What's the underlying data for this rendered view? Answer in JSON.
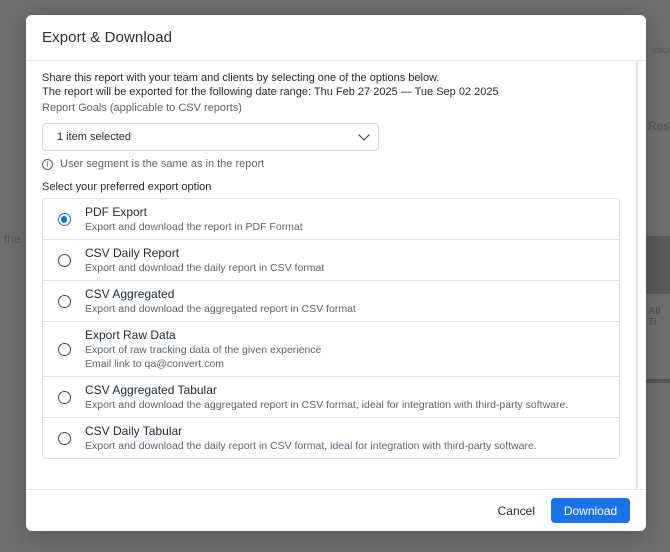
{
  "backdrop": {
    "left_fragment": "the",
    "right_fragment_1": "Rese",
    "right_fragment_2": "All Ti",
    "top_fragment": "ssion"
  },
  "modal": {
    "title": "Export & Download",
    "intro_line1": "Share this report with your team and clients by selecting one of the options below.",
    "intro_line2": "The report will be exported for the following date range: Thu Feb 27 2025 — Tue Sep 02 2025",
    "goals_label": "Report Goals (applicable to CSV reports)",
    "goals_select_value": "1 item selected",
    "info_text": "User segment is the same as in the report",
    "section_label": "Select your preferred export option",
    "options": [
      {
        "title": "PDF Export",
        "desc": "Export and download the report in PDF Format",
        "checked": true
      },
      {
        "title": "CSV Daily Report",
        "desc": "Export and download the daily report in CSV format",
        "checked": false
      },
      {
        "title": "CSV Aggregated",
        "desc": "Export and download the aggregated report in CSV format",
        "checked": false
      },
      {
        "title": "Export Raw Data",
        "desc": "Export of raw tracking data of the given experience",
        "desc2": "Email link to qa@convert.com",
        "checked": false
      },
      {
        "title": "CSV Aggregated Tabular",
        "desc": "Export and download the aggregated report in CSV format, ideal for integration with third-party software.",
        "checked": false
      },
      {
        "title": "CSV Daily Tabular",
        "desc": "Export and download the daily report in CSV format, ideal for integration with third-party software.",
        "checked": false
      }
    ],
    "cancel_label": "Cancel",
    "download_label": "Download"
  },
  "colors": {
    "accent": "#1a73e8",
    "overlay": "#6f6f6f"
  }
}
